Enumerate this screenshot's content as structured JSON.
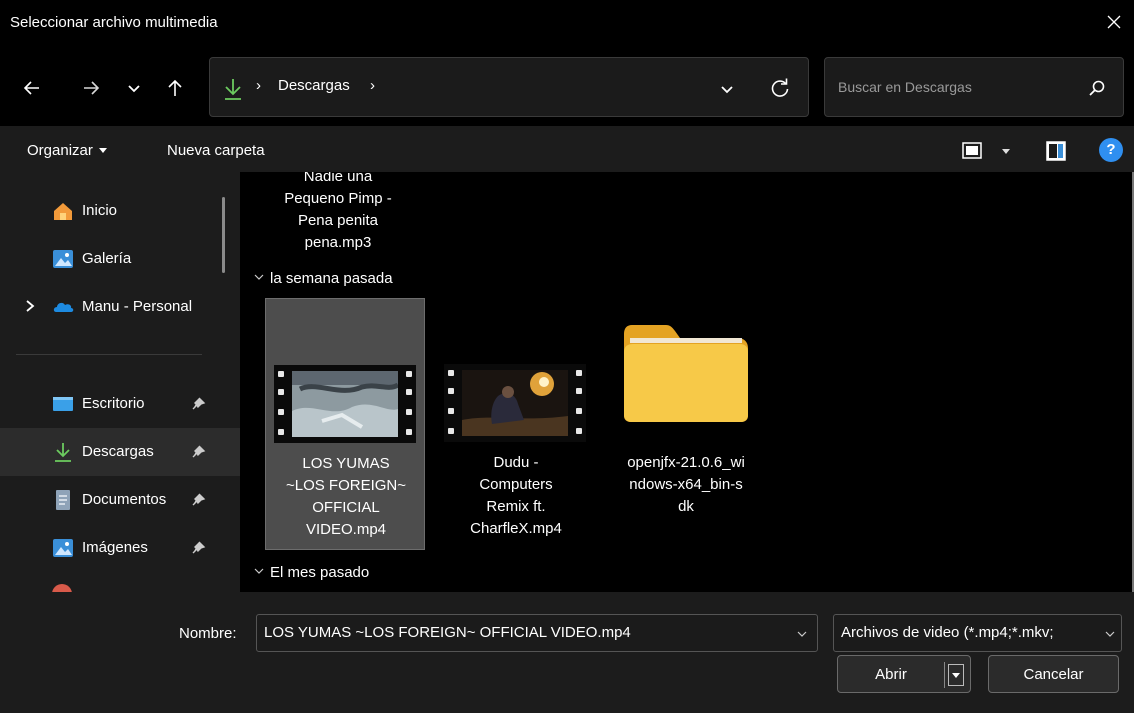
{
  "window": {
    "title": "Seleccionar archivo multimedia"
  },
  "address": {
    "crumb": "Descargas",
    "separator": "›"
  },
  "search": {
    "placeholder": "Buscar en Descargas"
  },
  "commands": {
    "organize": "Organizar",
    "new_folder": "Nueva carpeta"
  },
  "sidebar": {
    "items": [
      {
        "label": "Inicio",
        "icon": "home-icon"
      },
      {
        "label": "Galería",
        "icon": "gallery-icon"
      },
      {
        "label": "Manu - Personal",
        "icon": "onedrive-cloud-icon"
      },
      {
        "label": "Escritorio",
        "icon": "desktop-icon",
        "pinned": true
      },
      {
        "label": "Descargas",
        "icon": "download-icon",
        "pinned": true,
        "selected": true
      },
      {
        "label": "Documentos",
        "icon": "document-icon",
        "pinned": true
      },
      {
        "label": "Imágenes",
        "icon": "pictures-icon",
        "pinned": true
      }
    ]
  },
  "content": {
    "previous_item": {
      "lines": [
        "Nadie una",
        "Pequeno Pimp -",
        "Pena penita",
        "pena.mp3"
      ]
    },
    "groups": [
      {
        "label": "la semana pasada"
      },
      {
        "label": "El mes pasado"
      }
    ],
    "files": [
      {
        "lines": [
          "LOS YUMAS",
          "~LOS FOREIGN~",
          "OFFICIAL",
          "VIDEO.mp4"
        ],
        "kind": "video",
        "selected": true
      },
      {
        "lines": [
          "Dudu -",
          "Computers",
          "Remix ft.",
          "CharfleX.mp4"
        ],
        "kind": "video",
        "selected": false
      },
      {
        "lines": [
          "openjfx-21.0.6_wi",
          "ndows-x64_bin-s",
          "dk"
        ],
        "kind": "folder",
        "selected": false
      }
    ]
  },
  "footer": {
    "name_label": "Nombre:",
    "name_value": "LOS YUMAS ~LOS FOREIGN~ OFFICIAL VIDEO.mp4",
    "file_type": "Archivos de video (*.mp4;*.mkv;",
    "open_label": "Abrir",
    "cancel_label": "Cancelar"
  },
  "colors": {
    "accent": "#4cc2ff",
    "download_green": "#6ccb5f",
    "folder_yellow": "#f7c948",
    "selection_bg": "#4d4d4d"
  }
}
